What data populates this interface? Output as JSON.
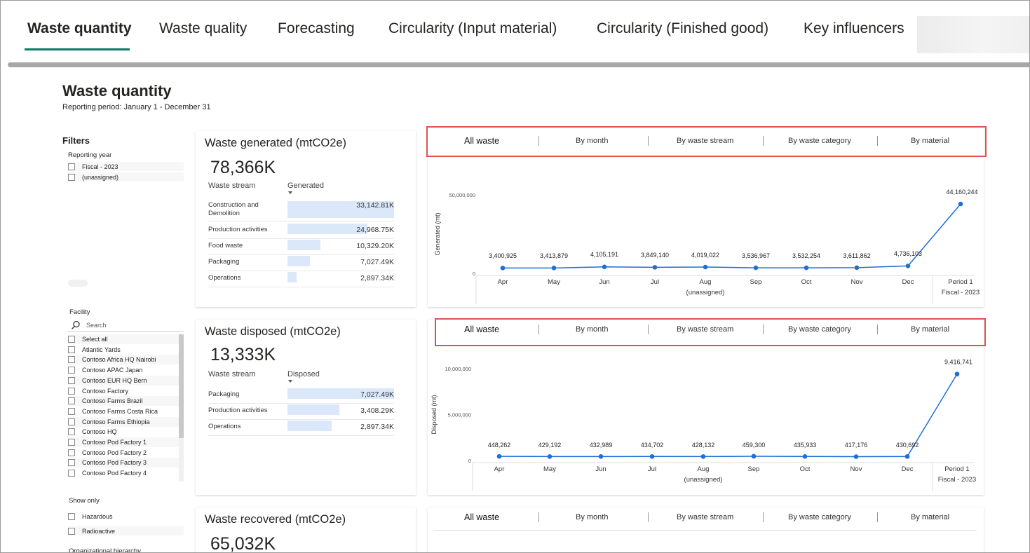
{
  "tabs": [
    {
      "label": "Waste quantity",
      "active": true
    },
    {
      "label": "Waste quality"
    },
    {
      "label": "Forecasting"
    },
    {
      "label": "Circularity (Input material)"
    },
    {
      "label": "Circularity (Finished good)"
    },
    {
      "label": "Key influencers"
    }
  ],
  "page": {
    "title": "Waste quantity",
    "subtitle": "Reporting period: January 1 - December 31"
  },
  "filters": {
    "heading": "Filters",
    "reporting_year": {
      "label": "Reporting year",
      "options": [
        "Fiscal - 2023",
        "(unassigned)"
      ]
    },
    "facility": {
      "label": "Facility",
      "search_placeholder": "Search",
      "items": [
        "Select all",
        "Atlantic Yards",
        "Contoso Africa HQ Nairobi",
        "Contoso APAC Japan",
        "Contoso EUR HQ Bern",
        "Contoso Factory",
        "Contoso Farms Brazil",
        "Contoso Farms Costa Rica",
        "Contoso Farms Ethiopia",
        "Contoso HQ",
        "Contoso Pod Factory 1",
        "Contoso Pod Factory 2",
        "Contoso Pod Factory 3",
        "Contoso Pod Factory 4"
      ]
    },
    "show_only": {
      "label": "Show only",
      "options": [
        "Hazardous",
        "Radioactive"
      ]
    },
    "org_hierarchy_label": "Organizational hierarchy"
  },
  "segments": [
    "All waste",
    "By month",
    "By waste stream",
    "By waste category",
    "By material"
  ],
  "cards": {
    "generated": {
      "title": "Waste generated (mtCO2e)",
      "total": "78,366K",
      "col_stream": "Waste stream",
      "col_value": "Generated",
      "rows": [
        {
          "label": "Construction and Demolition",
          "value": "33,142.81K",
          "share": 1.0
        },
        {
          "label": "Production activities",
          "value": "24,968.75K",
          "share": 0.753
        },
        {
          "label": "Food waste",
          "value": "10,329.20K",
          "share": 0.312
        },
        {
          "label": "Packaging",
          "value": "7,027.49K",
          "share": 0.212
        },
        {
          "label": "Operations",
          "value": "2,897.34K",
          "share": 0.087
        }
      ]
    },
    "disposed": {
      "title": "Waste disposed (mtCO2e)",
      "total": "13,333K",
      "col_stream": "Waste stream",
      "col_value": "Disposed",
      "rows": [
        {
          "label": "Packaging",
          "value": "7,027.49K",
          "share": 1.0
        },
        {
          "label": "Production activities",
          "value": "3,408.29K",
          "share": 0.485
        },
        {
          "label": "Operations",
          "value": "2,897.34K",
          "share": 0.412
        }
      ]
    },
    "recovered": {
      "title": "Waste recovered (mtCO2e)",
      "total": "65,032K"
    }
  },
  "chart_data": [
    {
      "type": "line",
      "ylabel": "Generated (mt)",
      "categories": [
        "Apr",
        "May",
        "Jun",
        "Jul",
        "Aug",
        "Sep",
        "Oct",
        "Nov",
        "Dec"
      ],
      "group_label": "(unassigned)",
      "extra_category": [
        "Period 1",
        "Fiscal - 2023"
      ],
      "values": [
        3400925,
        3413879,
        4105191,
        3849140,
        4019022,
        3536967,
        3532254,
        3611862,
        4736103,
        44160244
      ],
      "labels": [
        "3,400,925",
        "3,413,879",
        "4,105,191",
        "3,849,140",
        "4,019,022",
        "3,536,967",
        "3,532,254",
        "3,611,862",
        "4,736,103",
        "44,160,244"
      ],
      "yticks": [
        "0",
        "50,000,000"
      ],
      "ylim": [
        0,
        50000000
      ],
      "color": "#1f6fd6"
    },
    {
      "type": "line",
      "ylabel": "Disposed (mt)",
      "categories": [
        "Apr",
        "May",
        "Jun",
        "Jul",
        "Aug",
        "Sep",
        "Oct",
        "Nov",
        "Dec"
      ],
      "group_label": "(unassigned)",
      "extra_category": [
        "Period 1",
        "Fiscal - 2023"
      ],
      "values": [
        448262,
        429192,
        432989,
        434702,
        428132,
        459300,
        435933,
        417176,
        430692,
        9416741
      ],
      "labels": [
        "448,262",
        "429,192",
        "432,989",
        "434,702",
        "428,132",
        "459,300",
        "435,933",
        "417,176",
        "430,692",
        "9,416,741"
      ],
      "yticks": [
        "0",
        "5,000,000",
        "10,000,000"
      ],
      "ylim": [
        0,
        10000000
      ],
      "color": "#1f6fd6"
    }
  ]
}
